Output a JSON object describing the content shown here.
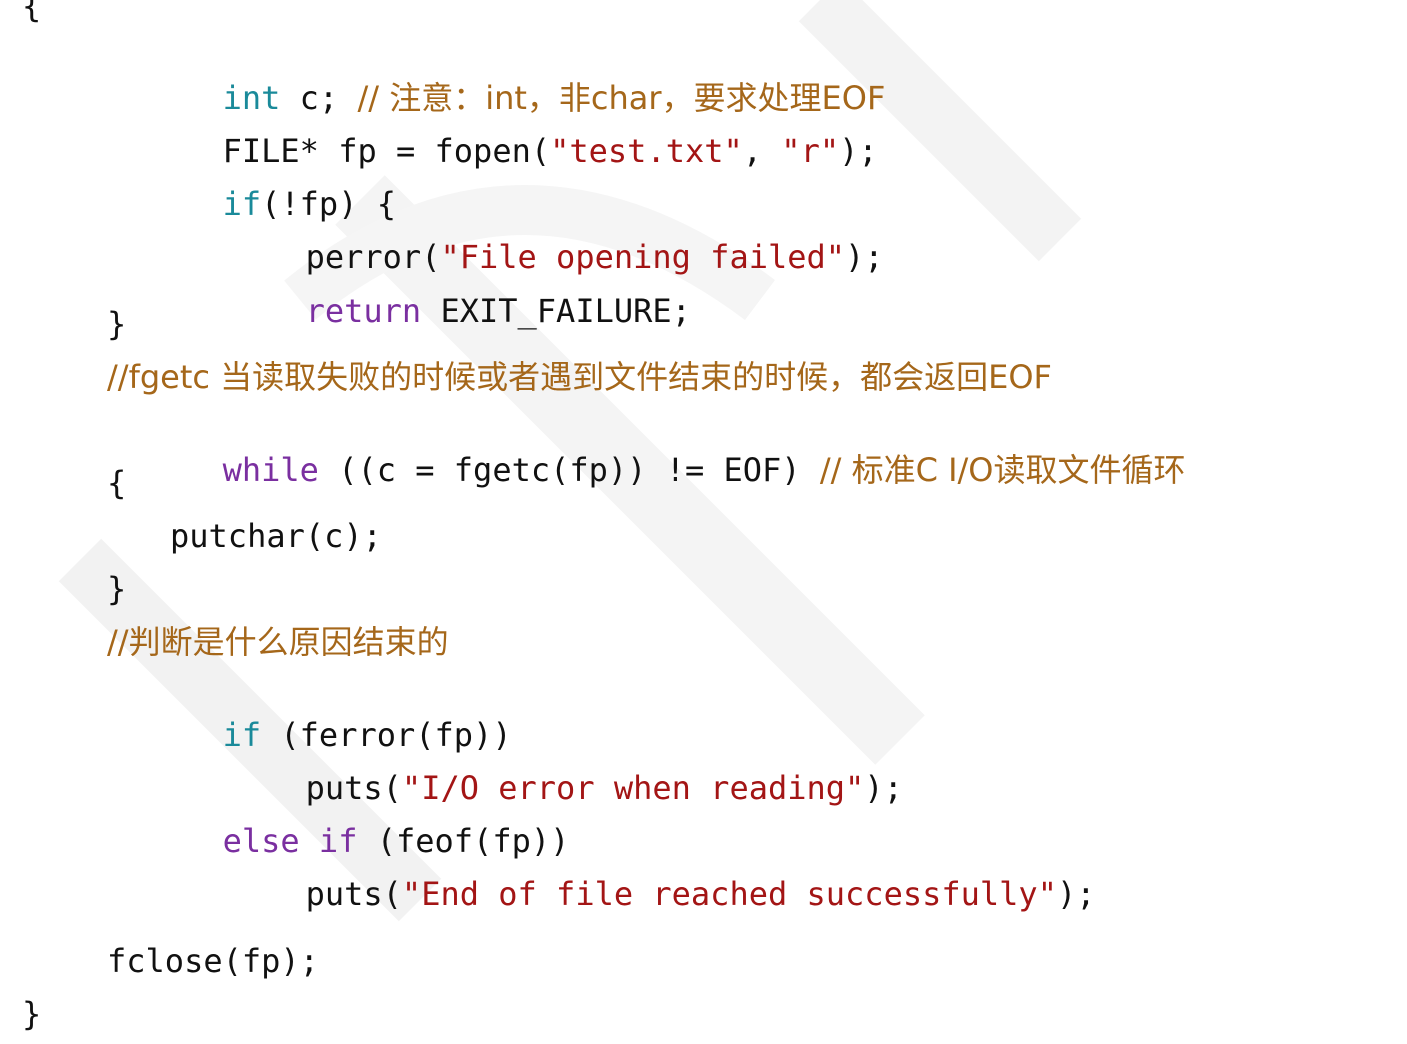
{
  "code": {
    "open_brace": "{",
    "l1": {
      "kw": "int",
      "rest": " c; ",
      "comment": "// 注意：int，非char，要求处理EOF"
    },
    "l2": {
      "a": "FILE* fp = fopen(",
      "s1": "\"test.txt\"",
      "b": ", ",
      "s2": "\"r\"",
      "c": ");"
    },
    "l3": {
      "kw": "if",
      "rest": "(!fp) {"
    },
    "l4": {
      "a": "perror(",
      "s": "\"File opening failed\"",
      "b": ");"
    },
    "l5": {
      "kw": "return",
      "rest": " EXIT_FAILURE;"
    },
    "l6": "}",
    "l7": "//fgetc 当读取失败的时候或者遇到文件结束的时候，都会返回EOF",
    "l8": {
      "kw": "while",
      "rest": " ((c = fgetc(fp)) != EOF) ",
      "comment": "// 标准C I/O读取文件循环"
    },
    "l9": "{",
    "l10": "putchar(c);",
    "l11": "}",
    "l12": "//判断是什么原因结束的",
    "l13": {
      "kw": "if",
      "rest": " (ferror(fp))"
    },
    "l14": {
      "a": "puts(",
      "s": "\"I/O error when reading\"",
      "b": ");"
    },
    "l15": {
      "kw": "else if",
      "rest": " (feof(fp))"
    },
    "l16": {
      "a": "puts(",
      "s": "\"End of file reached successfully\"",
      "b": ");"
    },
    "l17": "fclose(fp);",
    "close_brace": "}"
  }
}
